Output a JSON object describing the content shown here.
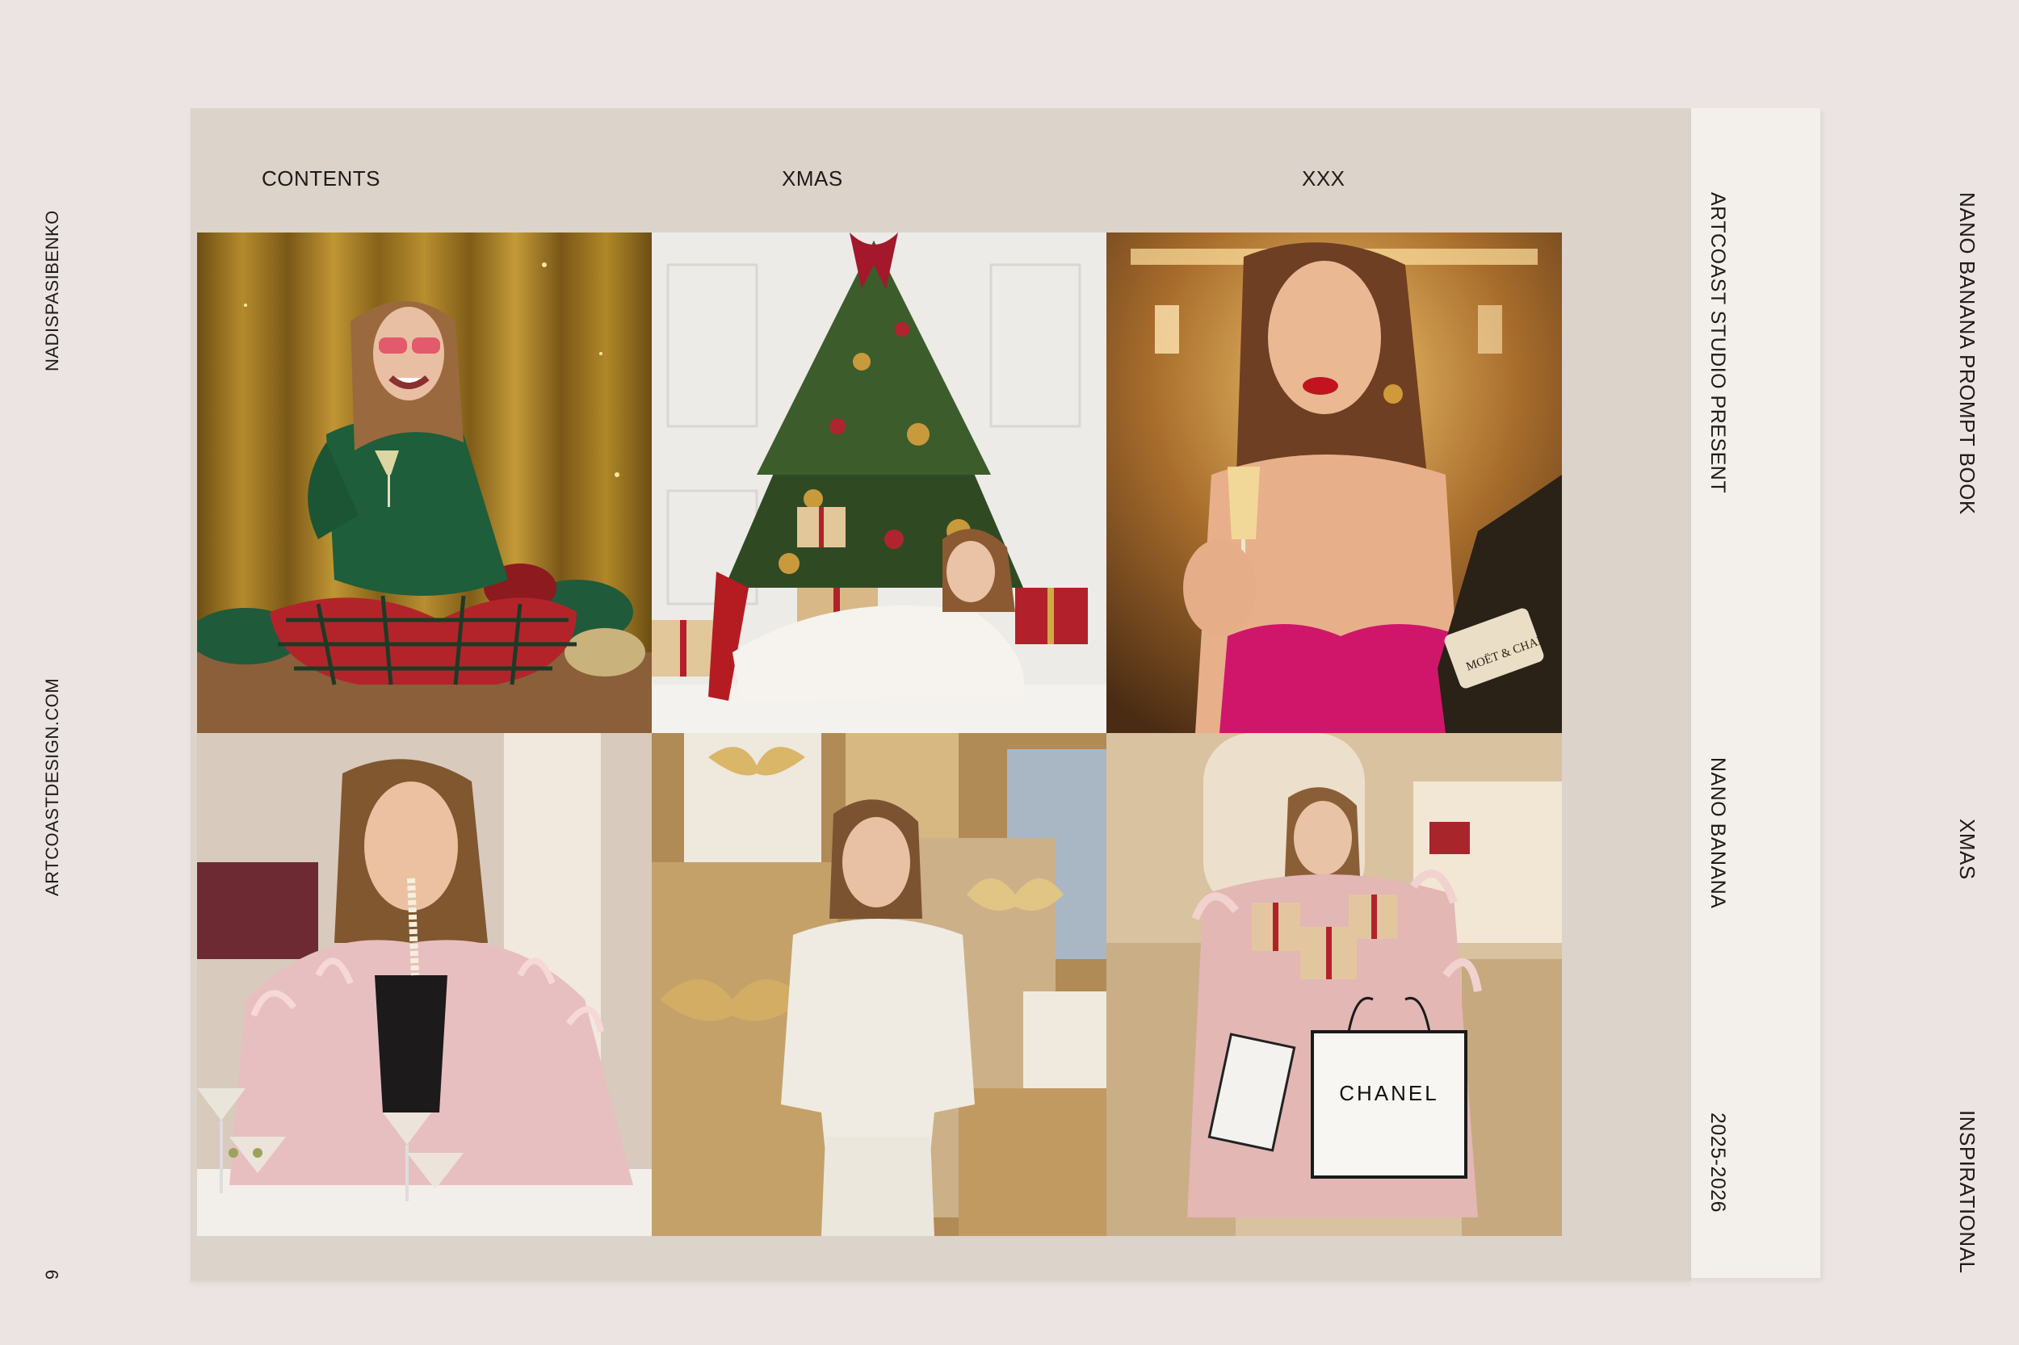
{
  "page_number": "9",
  "left_margin": {
    "author": "NADISPASIBENKO",
    "website": "ARTCOASTDESIGN.COM"
  },
  "header": {
    "col1": "CONTENTS",
    "col2": "XMAS",
    "col3": "XXX"
  },
  "strip": {
    "presenter": "ARTCOAST STUDIO PRESENT",
    "product": "NANO BANANA",
    "years": "2025-2026"
  },
  "right_margin": {
    "book_title": "NANO BANANA  PROMPT BOOK",
    "theme": "XMAS",
    "category": "INSPIRATIONAL"
  },
  "photos": [
    {
      "name": "photo-woman-green-sweater-gold-curtain"
    },
    {
      "name": "photo-woman-white-fur-christmas-tree"
    },
    {
      "name": "photo-woman-pink-dress-champagne"
    },
    {
      "name": "photo-woman-pink-feather-coat-martini"
    },
    {
      "name": "photo-woman-white-tracksuit-gold-gifts"
    },
    {
      "name": "photo-woman-pink-fur-shopping-bags"
    }
  ],
  "bottle_label": "MOËT & CHANDON",
  "bag_label": "CHANEL",
  "colors": {
    "background": "#ebe4e2",
    "panel": "#dcd3cb",
    "strip": "#f3f0eb",
    "text": "#1e1b19"
  }
}
